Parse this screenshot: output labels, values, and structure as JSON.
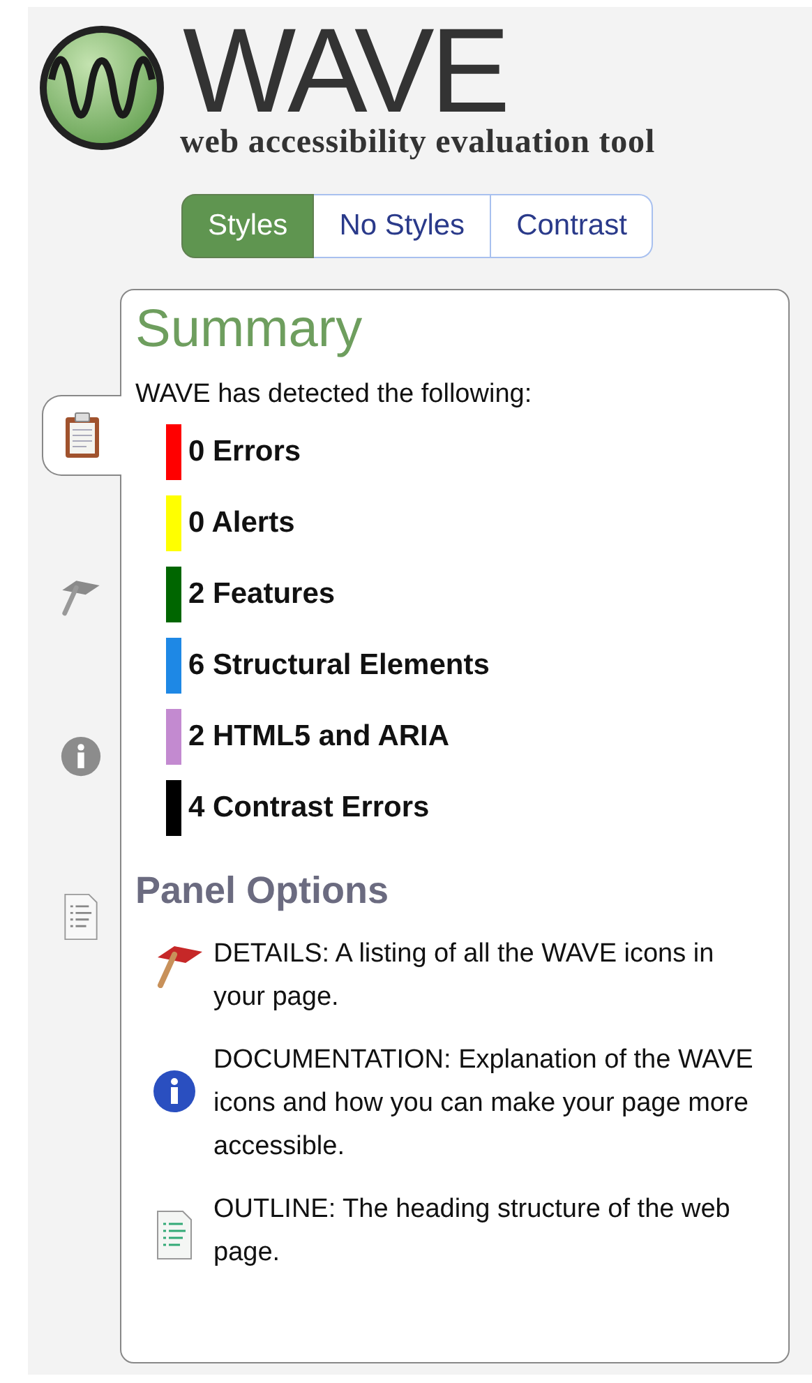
{
  "logo": {
    "title": "WAVE",
    "subtitle": "web accessibility evaluation tool"
  },
  "view_toggle": [
    {
      "label": "Styles",
      "selected": true
    },
    {
      "label": "No Styles",
      "selected": false
    },
    {
      "label": "Contrast",
      "selected": false
    }
  ],
  "side_tabs": [
    {
      "kind": "summary",
      "selected": true
    },
    {
      "kind": "details",
      "selected": false
    },
    {
      "kind": "documentation",
      "selected": false
    },
    {
      "kind": "outline",
      "selected": false
    }
  ],
  "summary": {
    "heading": "Summary",
    "intro": "WAVE has detected the following:",
    "items": [
      {
        "label": "0 Errors",
        "color": "#ff0000"
      },
      {
        "label": "0 Alerts",
        "color": "#ffff00"
      },
      {
        "label": "2 Features",
        "color": "#006600"
      },
      {
        "label": "6 Structural Elements",
        "color": "#1e88e5"
      },
      {
        "label": "2 HTML5 and ARIA",
        "color": "#c38ad0"
      },
      {
        "label": "4 Contrast Errors",
        "color": "#000000"
      }
    ]
  },
  "panel_options": {
    "heading": "Panel Options",
    "options": [
      {
        "kind": "details",
        "text": "DETAILS: A listing of all the WAVE icons in your page."
      },
      {
        "kind": "documentation",
        "text": "DOCUMENTATION: Explanation of the WAVE icons and how you can make your page more accessible."
      },
      {
        "kind": "outline",
        "text": "OUTLINE: The heading structure of the web page."
      }
    ]
  }
}
